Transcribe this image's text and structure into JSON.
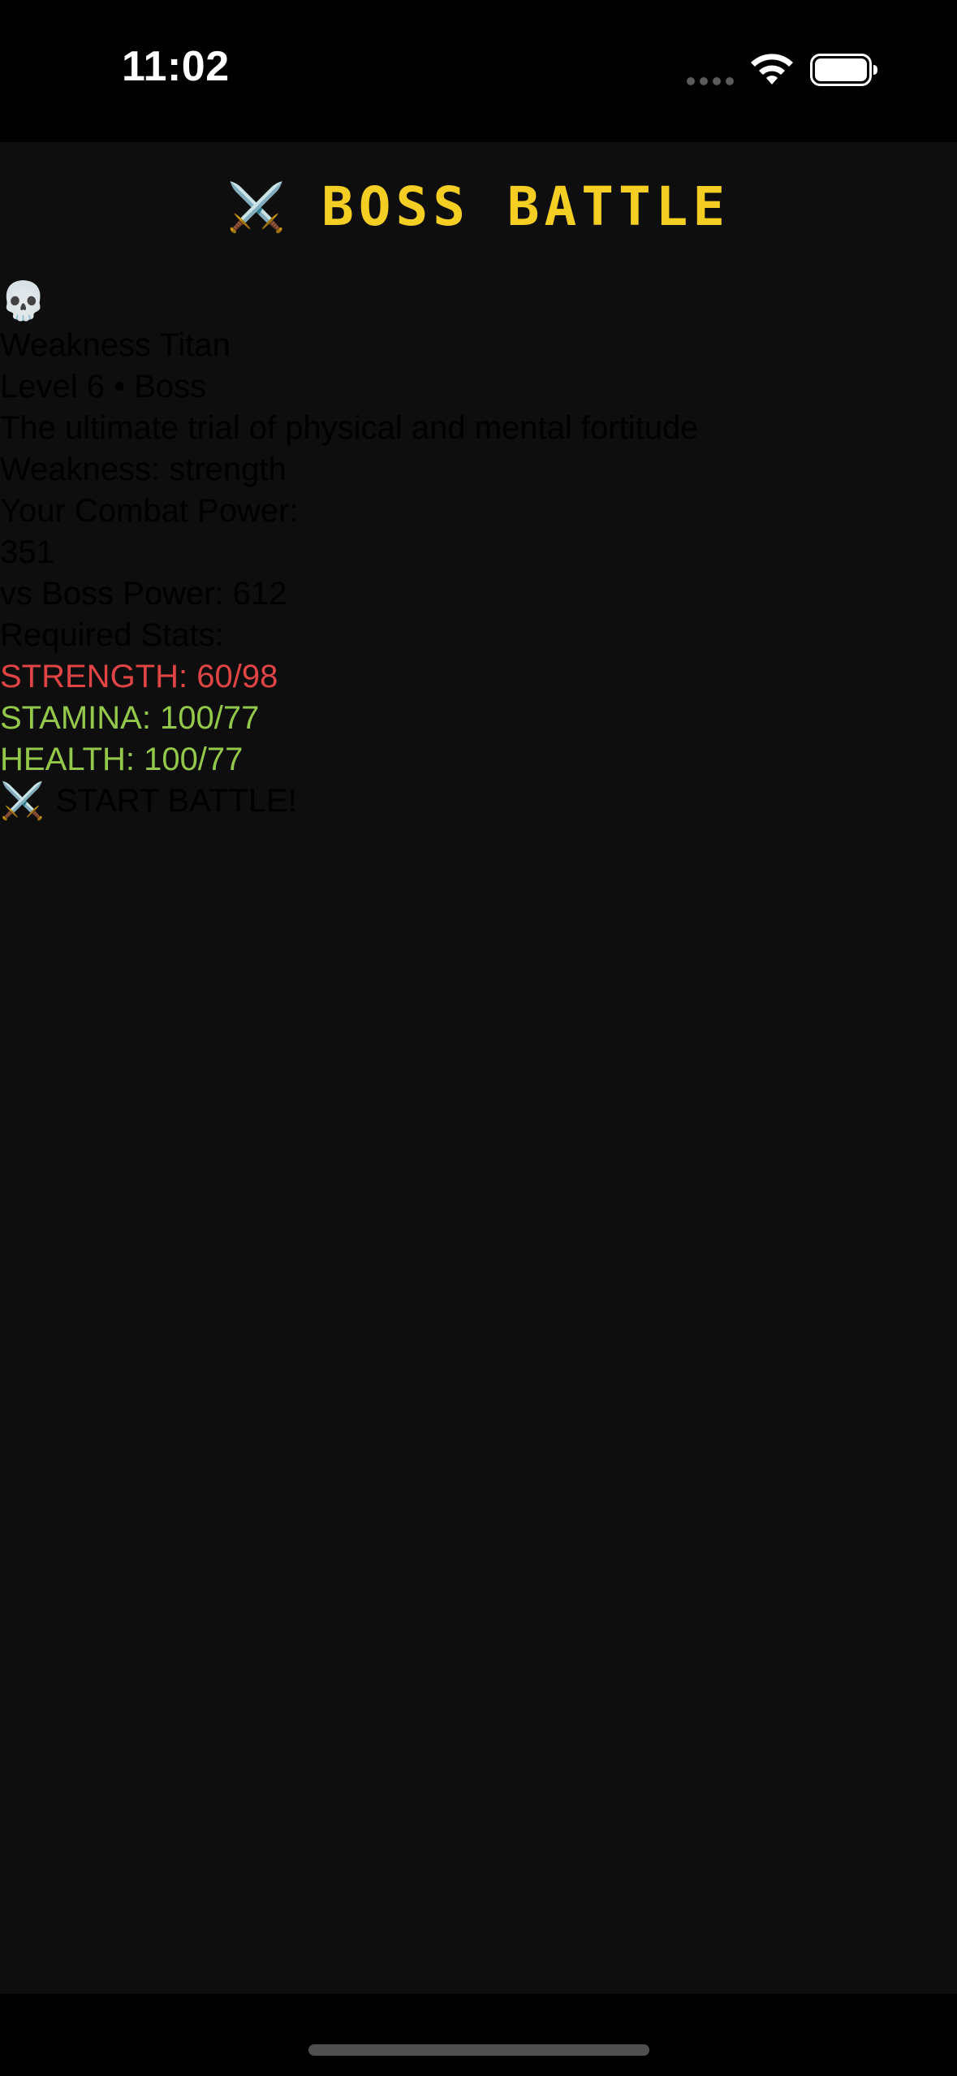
{
  "status_bar": {
    "time": "11:02",
    "wifi_icon": "wifi-icon",
    "battery_icon": "battery-icon"
  },
  "header": {
    "icon": "⚔️",
    "title": "BOSS BATTLE",
    "title_color": "#f4ce22"
  },
  "boss": {
    "icon": "💀",
    "name": "Weakness Titan",
    "level_line": "Level 6 • Boss",
    "description": "The ultimate trial of physical and mental fortitude",
    "weakness": "Weakness: strength"
  },
  "combat": {
    "your_power_label": "Your Combat Power:",
    "your_power_value": "351",
    "boss_power": "vs Boss Power: 612"
  },
  "requirements": {
    "label": "Required Stats:",
    "stats": [
      {
        "text": "STRENGTH: 60/98",
        "status": "low",
        "color": "#e04444"
      },
      {
        "text": "STAMINA: 100/77",
        "status": "ok",
        "color": "#93c84a"
      },
      {
        "text": "HEALTH: 100/77",
        "status": "ok",
        "color": "#93c84a"
      }
    ]
  },
  "start_button": {
    "icon": "⚔️",
    "label": "START BATTLE!"
  },
  "colors": {
    "background": "#0e0e0e",
    "status_bar": "#000000"
  }
}
